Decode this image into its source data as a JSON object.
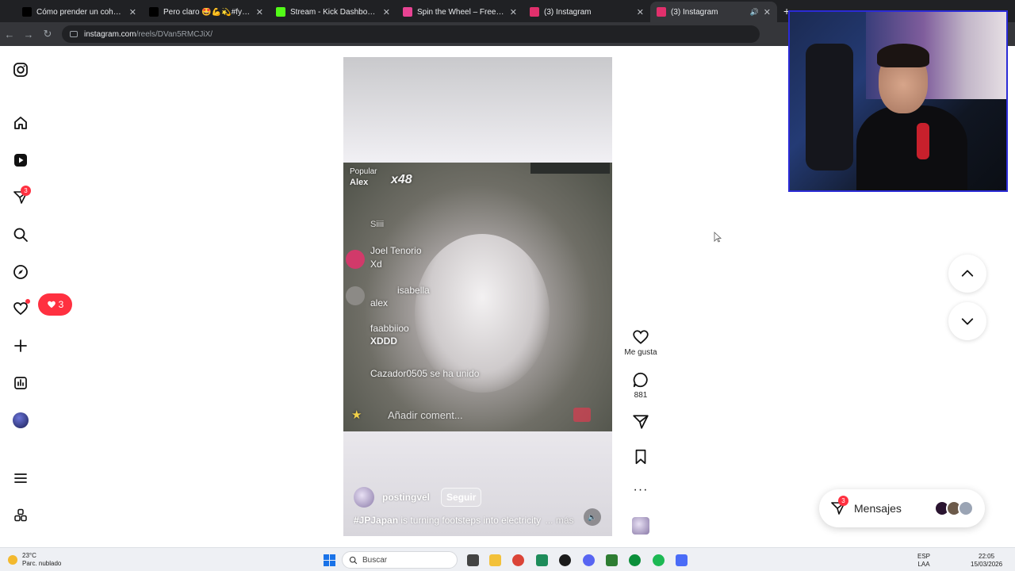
{
  "browser": {
    "tabs": [
      {
        "label": "Cómo prender un cohete de fu",
        "favicon_color": "#000000",
        "active": false
      },
      {
        "label": "Pero claro 🤩💪💫#fyppp #la",
        "favicon_color": "#000000",
        "active": false
      },
      {
        "label": "Stream - Kick Dashboard",
        "favicon_color": "#53fc18",
        "active": false
      },
      {
        "label": "Spin the Wheel – Free Wheel Sp",
        "favicon_color": "#e84393",
        "active": false
      },
      {
        "label": "(3) Instagram",
        "favicon_color": "#e1306c",
        "active": false
      },
      {
        "label": "(3) Instagram",
        "favicon_color": "#e1306c",
        "active": true
      }
    ],
    "url_host": "instagram.com",
    "url_path": "/reels/DVan5RMCJiX/"
  },
  "sidebar": {
    "items": [
      {
        "name": "instagram-logo-icon"
      },
      {
        "name": "home-icon"
      },
      {
        "name": "reels-icon"
      },
      {
        "name": "messages-icon",
        "badge": "3"
      },
      {
        "name": "search-icon"
      },
      {
        "name": "explore-icon"
      },
      {
        "name": "notifications-icon"
      },
      {
        "name": "create-icon"
      },
      {
        "name": "dashboard-icon"
      },
      {
        "name": "profile-avatar"
      },
      {
        "name": "more-menu-icon"
      },
      {
        "name": "also-from-meta-icon"
      }
    ],
    "notification_pill_count": "3"
  },
  "reel": {
    "overlay": {
      "popular_label": "Popular",
      "popular_user": "Alex",
      "multiplier": "x48",
      "comments": [
        {
          "user": "",
          "text": "Siiii"
        },
        {
          "user": "Joel Tenorio",
          "text": "Xd"
        },
        {
          "user": "isabella",
          "text": "alex"
        },
        {
          "user": "faabbiioo",
          "text": "XDDD"
        }
      ],
      "joined_text": "Cazador0505 se ha unido",
      "comment_placeholder": "Añadir coment..."
    },
    "author": "postingvel",
    "follow_label": "Seguir",
    "caption_tag": "#JPJapan",
    "caption_text": " is turning footsteps into electricity",
    "caption_more": "... más"
  },
  "actions": {
    "like_label": "Me gusta",
    "comment_count": "881"
  },
  "messages_bar": {
    "label": "Mensajes",
    "badge": "3"
  },
  "taskbar": {
    "weather_temp": "23°C",
    "weather_desc": "Parc. nublado",
    "search_placeholder": "Buscar",
    "lang_top": "ESP",
    "lang_bottom": "LAA",
    "time": "22:05",
    "date": "15/03/2026"
  },
  "colors": {
    "accent_red": "#ff3040",
    "webcam_border": "#2b2bd6"
  }
}
